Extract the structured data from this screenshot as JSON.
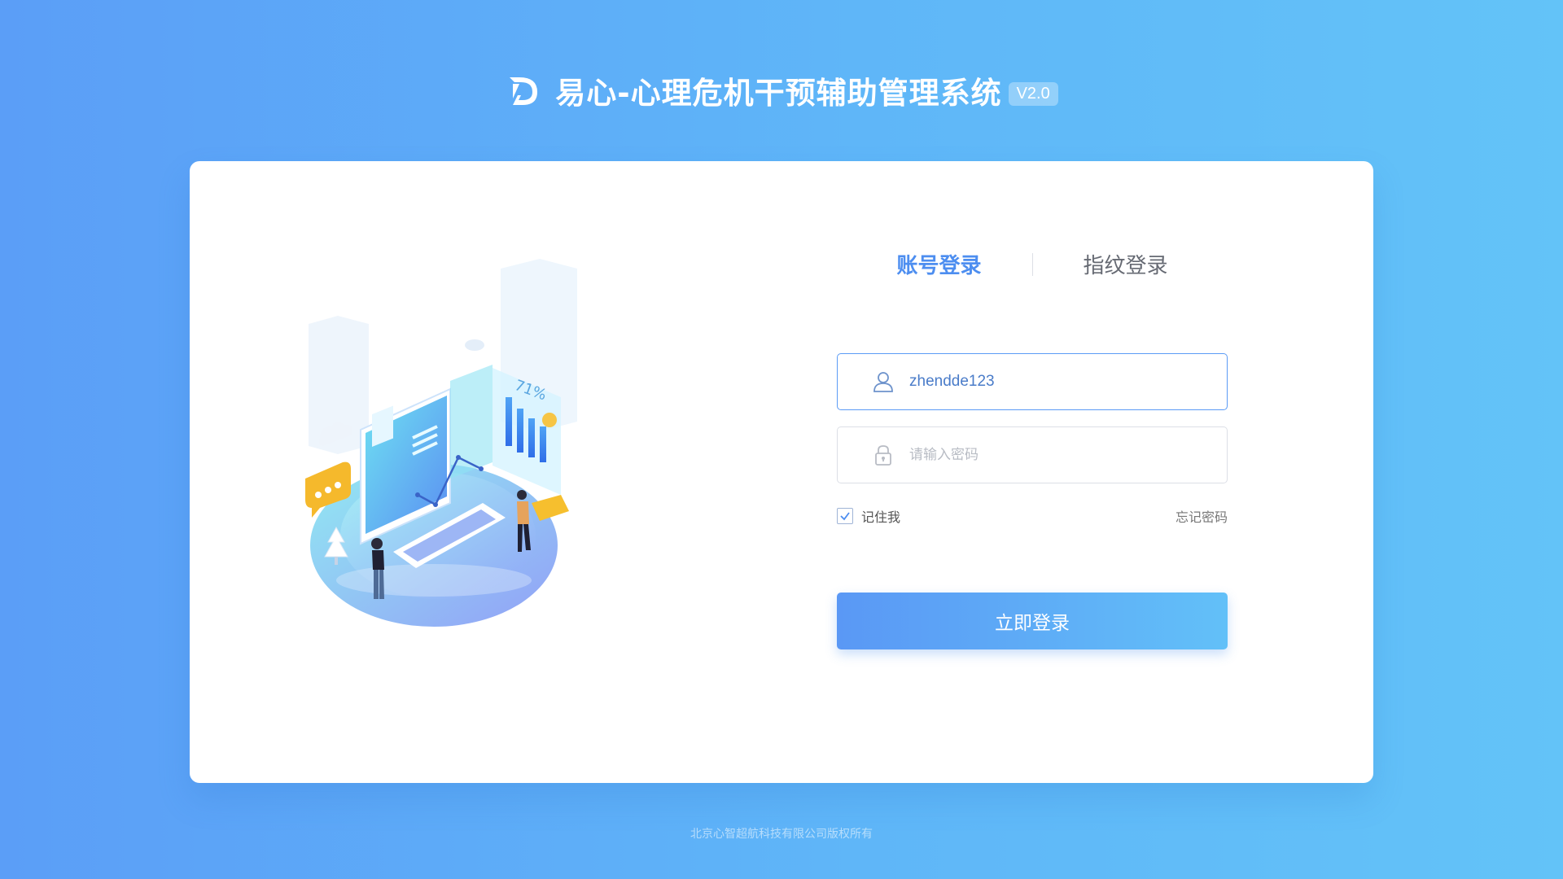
{
  "header": {
    "title": "易心-心理危机干预辅助管理系统",
    "version": "V2.0",
    "logo_icon": "ym-logo-icon"
  },
  "illustration": {
    "percent_label": "71%"
  },
  "login": {
    "tabs": [
      {
        "label": "账号登录",
        "active": true
      },
      {
        "label": "指纹登录",
        "active": false
      }
    ],
    "username": {
      "value": "zhendde123",
      "icon": "user-icon"
    },
    "password": {
      "placeholder": "请输入密码",
      "icon": "lock-icon"
    },
    "remember_label": "记住我",
    "remember_checked": true,
    "forgot_label": "忘记密码",
    "submit_label": "立即登录"
  },
  "footer": {
    "copyright": "北京心智超航科技有限公司版权所有"
  },
  "colors": {
    "accent": "#4d8ef0",
    "bg_start": "#5b9ef7",
    "bg_end": "#63c3f8"
  }
}
